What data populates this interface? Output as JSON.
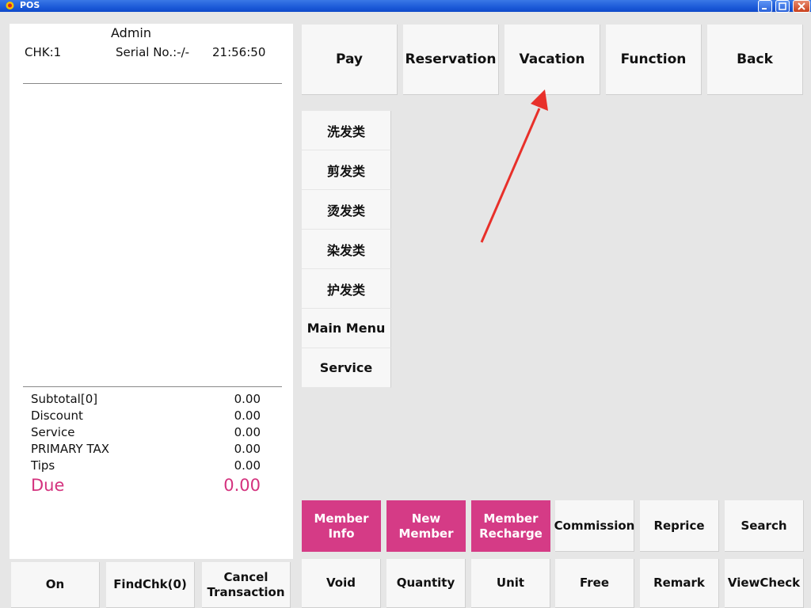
{
  "window": {
    "title": "POS"
  },
  "receipt": {
    "operator": "Admin",
    "check": "CHK:1",
    "serial": "Serial No.:-/-",
    "time": "21:56:50",
    "totals": [
      {
        "label": "Subtotal[0]",
        "value": "0.00"
      },
      {
        "label": "Discount",
        "value": "0.00"
      },
      {
        "label": "Service",
        "value": "0.00"
      },
      {
        "label": "PRIMARY TAX",
        "value": "0.00"
      },
      {
        "label": "Tips",
        "value": "0.00"
      }
    ],
    "due_label": "Due",
    "due_value": "0.00"
  },
  "top_buttons": [
    "Pay",
    "Reservation",
    "Vacation",
    "Function",
    "Back"
  ],
  "categories": [
    "洗发类",
    "剪发类",
    "烫发类",
    "染发类",
    "护发类",
    "Main Menu",
    "Service"
  ],
  "member_row": [
    "Member Info",
    "New\nMember",
    "Member\nRecharge",
    "Commission",
    "Reprice",
    "Search"
  ],
  "action_row": [
    "Void",
    "Quantity",
    "Unit",
    "Free",
    "Remark",
    "ViewCheck"
  ],
  "bottom_left": [
    "On",
    "FindChk(0)",
    "Cancel\nTransaction"
  ],
  "colors": {
    "accent_pink": "#d53b86",
    "due_pink": "#d4327e",
    "annotation_red": "#e8302a",
    "titlebar_blue": "#1c5ad8"
  },
  "annotation": {
    "type": "red-arrow",
    "points_to": "Vacation"
  }
}
